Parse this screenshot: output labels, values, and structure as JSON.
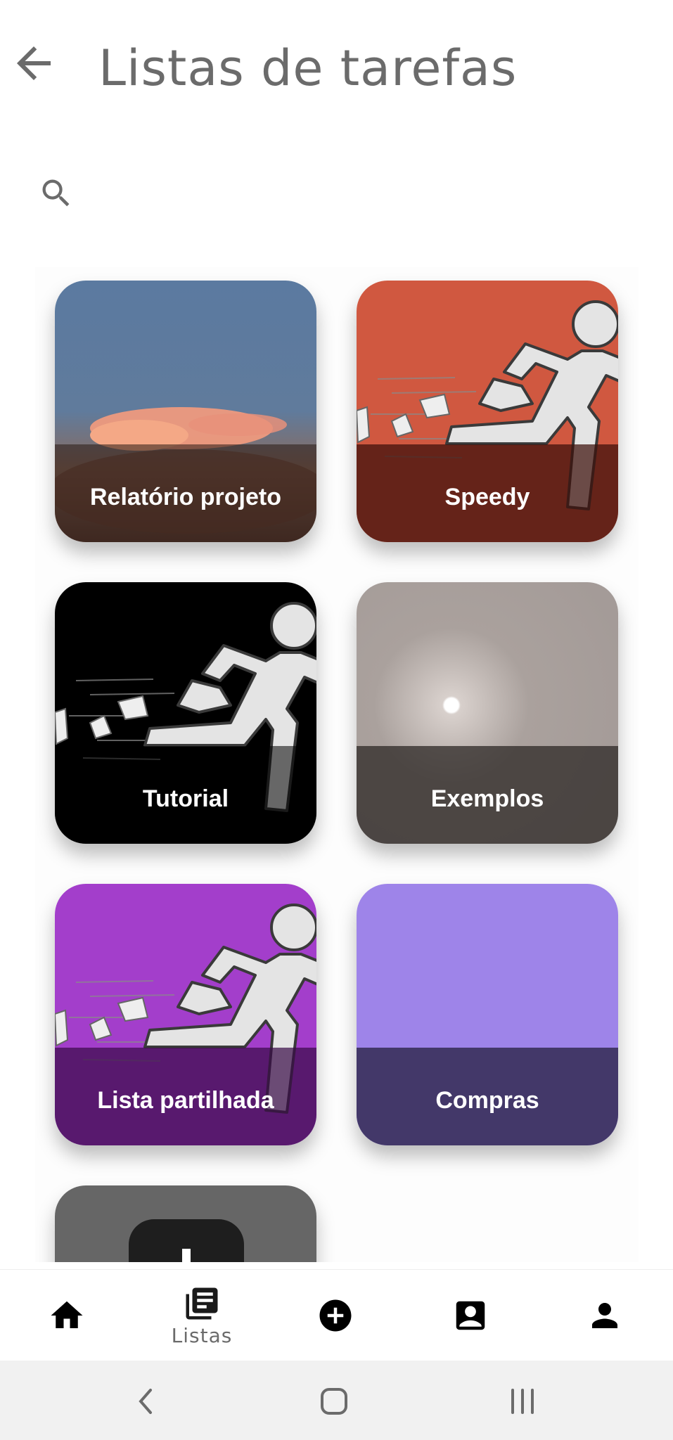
{
  "header": {
    "title": "Listas de tarefas"
  },
  "search": {
    "icon": "search-icon"
  },
  "lists": [
    {
      "name": "Relatório projeto",
      "background": "sky-clouds"
    },
    {
      "name": "Speedy",
      "background": "runner",
      "color": "#d05840"
    },
    {
      "name": "Tutorial",
      "background": "runner",
      "color": "#000000"
    },
    {
      "name": "Exemplos",
      "background": "hazy-sun"
    },
    {
      "name": "Lista partilhada",
      "background": "runner",
      "color": "#a33ecb"
    },
    {
      "name": "Compras",
      "background": "solid",
      "color": "#9e84e9"
    },
    {
      "name": "",
      "background": "solid",
      "color": "#666666"
    }
  ],
  "bottom_nav": {
    "items": [
      {
        "icon": "home-icon",
        "label": ""
      },
      {
        "icon": "lists-icon",
        "label": "Listas"
      },
      {
        "icon": "add-circle-icon",
        "label": ""
      },
      {
        "icon": "contact-card-icon",
        "label": ""
      },
      {
        "icon": "person-icon",
        "label": ""
      }
    ]
  },
  "system_nav": {
    "icons": [
      "back-icon",
      "home-icon",
      "recents-icon"
    ]
  }
}
